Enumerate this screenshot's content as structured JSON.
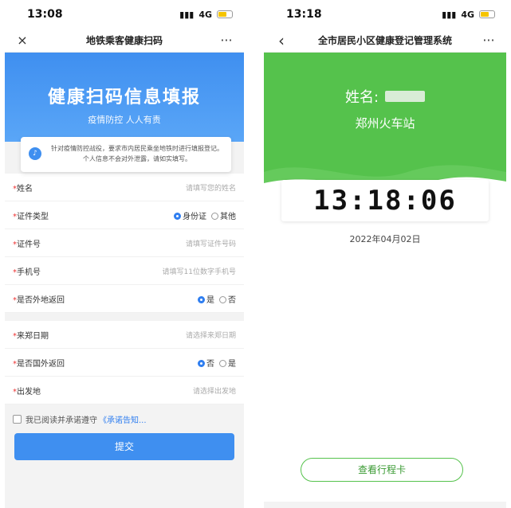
{
  "left": {
    "status": {
      "time": "13:08",
      "signal": "4G"
    },
    "nav": {
      "close": "×",
      "title": "地铁乘客健康扫码",
      "more": "···"
    },
    "banner": {
      "title": "健康扫码信息填报",
      "subtitle": "疫情防控 人人有责"
    },
    "notice": "针对疫情防控战役，要求市内居民乘坐地铁时进行填报登记。个人信息不会对外泄露，请如实填写。",
    "fields": [
      {
        "label": "姓名",
        "placeholder": "请填写您的姓名"
      },
      {
        "label": "证件类型",
        "options": [
          "身份证",
          "其他"
        ]
      },
      {
        "label": "证件号",
        "placeholder": "请填写证件号码"
      },
      {
        "label": "手机号",
        "placeholder": "请填写11位数字手机号"
      },
      {
        "label": "是否外地返回",
        "options": [
          "是",
          "否"
        ]
      },
      {
        "label": "来郑日期",
        "placeholder": "请选择来郑日期"
      },
      {
        "label": "是否国外返回",
        "options": [
          "否",
          "是"
        ]
      },
      {
        "label": "出发地",
        "placeholder": "请选择出发地"
      }
    ],
    "agree": {
      "text": "我已阅读并承诺遵守",
      "link": "《承诺告知..."
    },
    "submit": "提交"
  },
  "right": {
    "status": {
      "time": "13:18",
      "signal": "4G"
    },
    "nav": {
      "back": "‹",
      "title": "全市居民小区健康登记管理系统",
      "more": "···"
    },
    "name_label": "姓名:",
    "station": "郑州火车站",
    "clock": "13:18:06",
    "date": "2022年04月02日",
    "itinerary_button": "查看行程卡"
  },
  "colors": {
    "blue": "#3f8ff0",
    "green": "#55c24c"
  }
}
